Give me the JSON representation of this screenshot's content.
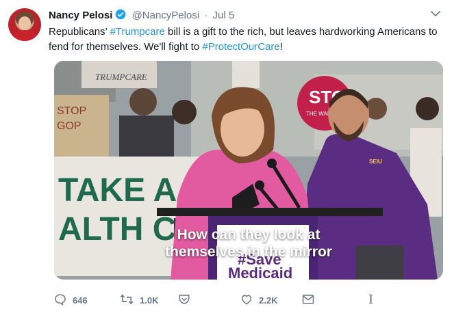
{
  "author": {
    "name": "Nancy Pelosi",
    "handle": "@NancyPelosi",
    "separator": "·",
    "time": "Jul 5"
  },
  "tweet": {
    "text_part1": "Republicans’ ",
    "hashtag1": "#Trumpcare",
    "text_part2": " bill is a gift to the rich, but leaves hardworking Americans to fend for themselves. We'll fight to ",
    "hashtag2": "#ProtectOurCare",
    "text_part3": "!"
  },
  "media": {
    "caption_line1": "How can they look at",
    "caption_line2": "themselves in the mirror",
    "sign_left_top": "TRUMPCARE",
    "sign_left_big1": "TAKE A",
    "sign_left_big2": "ALTH C",
    "sign_stop_top": "STOP",
    "sign_stop_bottom": "GOP",
    "sign_red": "STO",
    "sign_red_sub": "THE WAR ON WOMEN",
    "podium_line1": "#Save",
    "podium_line2": "Medicaid",
    "shirt_logo": "SEIU"
  },
  "actions": {
    "replies": "646",
    "retweets": "1.0K",
    "likes": "2.2K"
  },
  "icons": {
    "verified": "verified-badge-icon",
    "chevron": "chevron-down-icon",
    "reply": "reply-icon",
    "retweet": "retweet-icon",
    "heart": "heart-icon",
    "message": "direct-message-icon",
    "save": "save-icon"
  },
  "colors": {
    "accent": "#1b95e0",
    "muted": "#657786",
    "text": "#14171a"
  }
}
